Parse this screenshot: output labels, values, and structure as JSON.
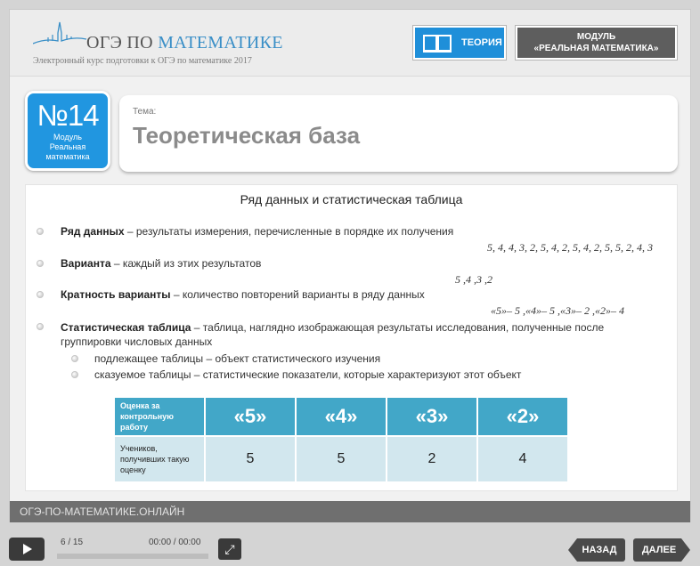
{
  "header": {
    "brand_part1": "ОГЭ ПО ",
    "brand_part2": "МАТЕМАТИКЕ",
    "subtitle": "Электронный курс подготовки к ОГЭ по математике 2017",
    "theory_button": "ТЕОРИЯ",
    "module_button_line1": "МОДУЛЬ",
    "module_button_line2": "«РЕАЛЬНАЯ МАТЕМАТИКА»"
  },
  "badge": {
    "number": "№14",
    "line1": "Модуль",
    "line2": "Реальная",
    "line3": "математика"
  },
  "topic": {
    "label": "Тема:",
    "title": "Теоретическая база"
  },
  "content": {
    "heading": "Ряд данных и статистическая таблица",
    "items": [
      {
        "term": "Ряд данных",
        "text": " – результаты измерения, перечисленные в порядке их получения",
        "example": "5, 4, 4, 3, 2, 5, 4, 2, 5, 4, 2, 5, 5, 2, 4, 3"
      },
      {
        "term": "Варианта",
        "text": " – каждый из этих результатов",
        "example": "5 ,4 ,3 ,2"
      },
      {
        "term": "Кратность варианты",
        "text": " – количество повторений варианты в ряду данных",
        "example": "«5»– 5 ,«4»– 5 ,«3»– 2 ,«2»– 4"
      },
      {
        "term": "Статистическая таблица",
        "text": " – таблица, наглядно изображающая результаты исследования, полученные после",
        "text2": "группировки числовых данных"
      }
    ],
    "subitems": [
      "подлежащее таблицы – объект статистического изучения",
      "сказуемое таблицы – статистические показатели, которые характеризуют этот объект"
    ],
    "table": {
      "header_label": "Оценка за контрольную работу",
      "grades": [
        "«5»",
        "«4»",
        "«3»",
        "«2»"
      ],
      "row_label": "Учеников, получивших такую оценку",
      "counts": [
        "5",
        "5",
        "2",
        "4"
      ]
    }
  },
  "footer": {
    "site": "ОГЭ-ПО-МАТЕМАТИКЕ.ОНЛАЙН"
  },
  "player": {
    "counter": "6 / 15",
    "time": "00:00 / 00:00",
    "back": "НАЗАД",
    "next": "ДАЛЕЕ"
  },
  "colors": {
    "accent": "#2196e0",
    "table_header": "#42a7c8",
    "table_row": "#d2e7ee"
  }
}
